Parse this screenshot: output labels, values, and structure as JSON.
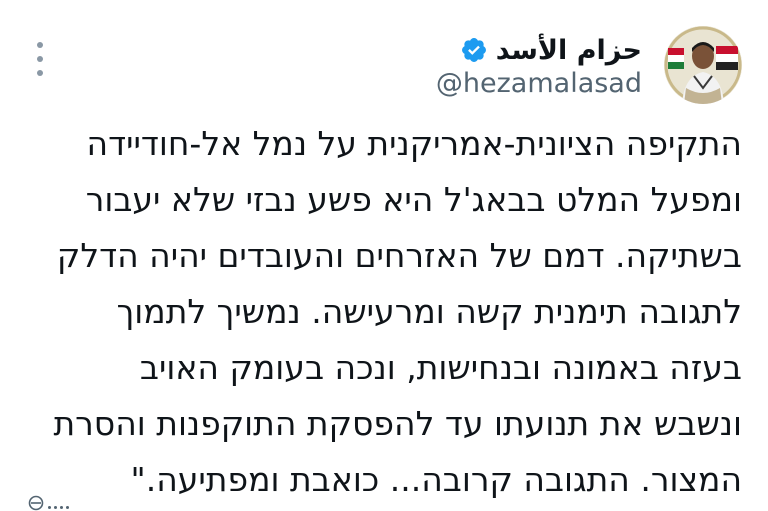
{
  "tweet": {
    "author": {
      "display_name": "حزام الأسد",
      "handle": "@hezamalasad",
      "verified": true
    },
    "text_lines": [
      "התקיפה הציונית-אמריקנית על נמל אל-חודיידה",
      "ומפעל המלט בבאג'ל היא פשע נבזי שלא יעבור",
      "בשתיקה. דמם של האזרחים והעובדים יהיה הדלק",
      "לתגובה תימנית קשה ומרעישה. נמשיך לתמוך",
      "בעזה באמונה ובנחישות, ונכה בעומק האויב",
      "ונשבש את תנועתו עד להפסקת התוקפנות והסרת",
      "המצור. התגובה קרובה... כואבת ומפתיעה.\""
    ]
  },
  "colors": {
    "text_primary": "#0f1419",
    "text_secondary": "#536471",
    "verified_blue": "#1d9bf0",
    "more_dots": "#8a98a5"
  },
  "icons": {
    "verified": "verified-badge-icon",
    "more": "more-options-icon",
    "avatar": "profile-avatar"
  }
}
